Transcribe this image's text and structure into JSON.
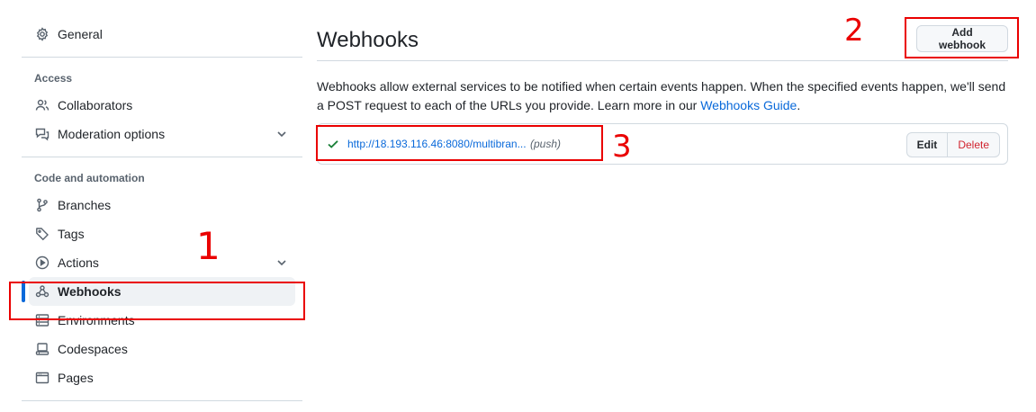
{
  "sidebar": {
    "general": "General",
    "access_title": "Access",
    "collaborators": "Collaborators",
    "moderation": "Moderation options",
    "code_title": "Code and automation",
    "branches": "Branches",
    "tags": "Tags",
    "actions": "Actions",
    "webhooks": "Webhooks",
    "environments": "Environments",
    "codespaces": "Codespaces",
    "pages": "Pages"
  },
  "main": {
    "title": "Webhooks",
    "add_button": "Add webhook",
    "description_text": "Webhooks allow external services to be notified when certain events happen. When the specified events happen, we'll send a POST request to each of the URLs you provide. Learn more in our ",
    "guide_link": "Webhooks Guide",
    "description_end": ".",
    "hook": {
      "url": "http://18.193.116.46:8080/multibran...",
      "events": "(push)",
      "status_icon": "check-icon",
      "edit": "Edit",
      "delete": "Delete"
    }
  },
  "annotations": {
    "one": "1",
    "two": "2",
    "three": "3",
    "color": "#ea0000"
  },
  "colors": {
    "accent": "#0969da",
    "success": "#1a7f37",
    "danger": "#d1242f"
  }
}
